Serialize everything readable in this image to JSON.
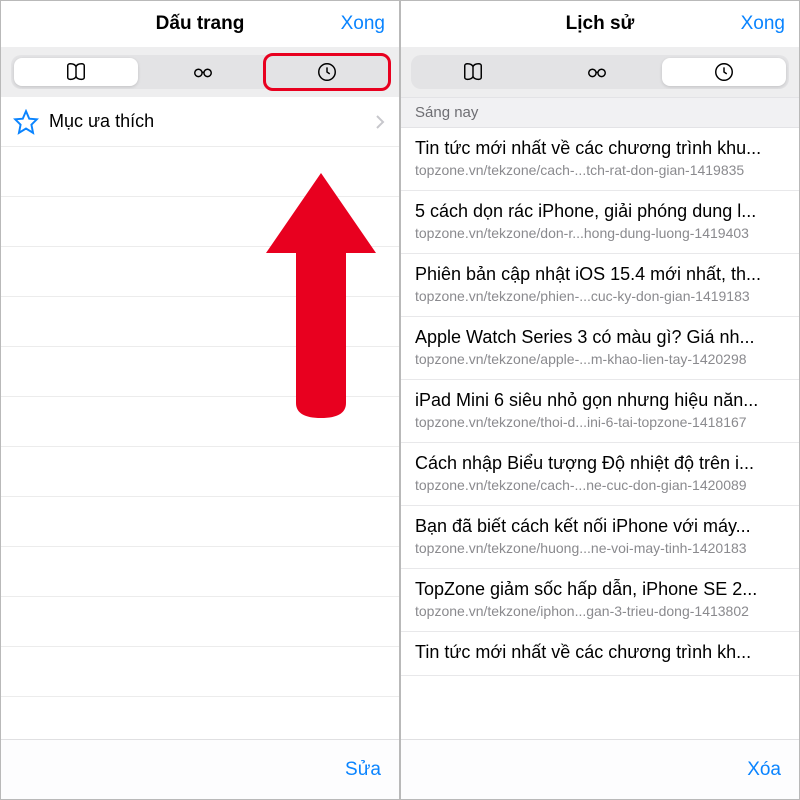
{
  "left": {
    "title": "Dấu trang",
    "done": "Xong",
    "favorites_label": "Mục ưa thích",
    "footer_button": "Sửa"
  },
  "right": {
    "title": "Lịch sử",
    "done": "Xong",
    "section": "Sáng nay",
    "footer_button": "Xóa",
    "items": [
      {
        "title": "Tin tức mới nhất về các chương trình khu...",
        "url": "topzone.vn/tekzone/cach-...tch-rat-don-gian-1419835"
      },
      {
        "title": "5 cách dọn rác iPhone, giải phóng dung l...",
        "url": "topzone.vn/tekzone/don-r...hong-dung-luong-1419403"
      },
      {
        "title": "Phiên bản cập nhật iOS 15.4 mới nhất, th...",
        "url": "topzone.vn/tekzone/phien-...cuc-ky-don-gian-1419183"
      },
      {
        "title": "Apple Watch Series 3 có màu gì? Giá nh...",
        "url": "topzone.vn/tekzone/apple-...m-khao-lien-tay-1420298"
      },
      {
        "title": "iPad Mini 6 siêu nhỏ gọn nhưng hiệu năn...",
        "url": "topzone.vn/tekzone/thoi-d...ini-6-tai-topzone-1418167"
      },
      {
        "title": "Cách nhập Biểu tượng Độ nhiệt độ trên i...",
        "url": "topzone.vn/tekzone/cach-...ne-cuc-don-gian-1420089"
      },
      {
        "title": "Bạn đã biết cách kết nối iPhone với máy...",
        "url": "topzone.vn/tekzone/huong...ne-voi-may-tinh-1420183"
      },
      {
        "title": "TopZone giảm sốc hấp dẫn, iPhone SE 2...",
        "url": "topzone.vn/tekzone/iphon...gan-3-trieu-dong-1413802"
      },
      {
        "title": "Tin tức mới nhất về các chương trình kh...",
        "url": ""
      }
    ]
  },
  "icons": {
    "book": "book-icon",
    "glasses": "glasses-icon",
    "clock": "clock-icon",
    "star": "star-icon",
    "chevron": "chevron-right-icon"
  },
  "colors": {
    "accent": "#0a84ff",
    "highlight": "#e8001f"
  }
}
